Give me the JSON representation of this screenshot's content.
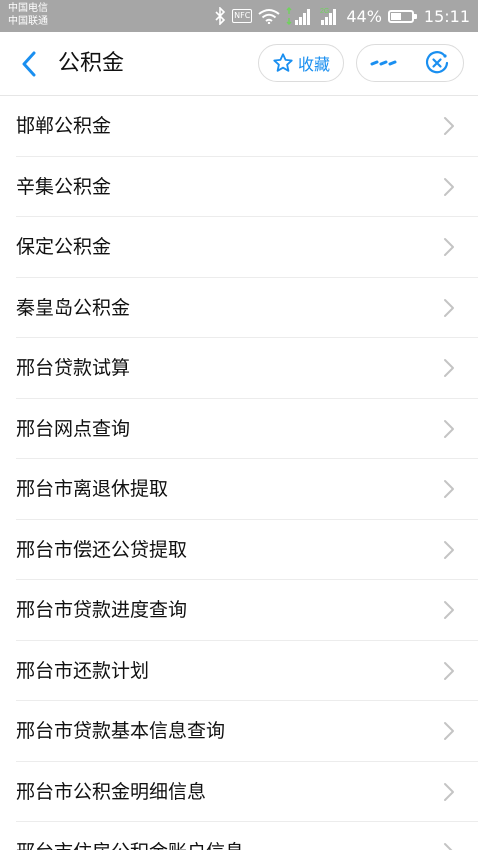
{
  "status_bar": {
    "carrier_1": "中国电信",
    "carrier_2": "中国联通",
    "nfc": "NFC",
    "battery_percent": "44%",
    "battery_level": 0.44,
    "time": "15:11"
  },
  "header": {
    "title": "公积金",
    "favorite_label": "收藏",
    "accent_color": "#1a8ff0"
  },
  "list": {
    "items": [
      {
        "label": "邯郸公积金"
      },
      {
        "label": "辛集公积金"
      },
      {
        "label": "保定公积金"
      },
      {
        "label": "秦皇岛公积金"
      },
      {
        "label": "邢台贷款试算"
      },
      {
        "label": "邢台网点查询"
      },
      {
        "label": "邢台市离退休提取"
      },
      {
        "label": "邢台市偿还公贷提取"
      },
      {
        "label": "邢台市贷款进度查询"
      },
      {
        "label": "邢台市还款计划"
      },
      {
        "label": "邢台市贷款基本信息查询"
      },
      {
        "label": "邢台市公积金明细信息"
      },
      {
        "label": "邢台市住房公积金账户信息"
      }
    ]
  }
}
